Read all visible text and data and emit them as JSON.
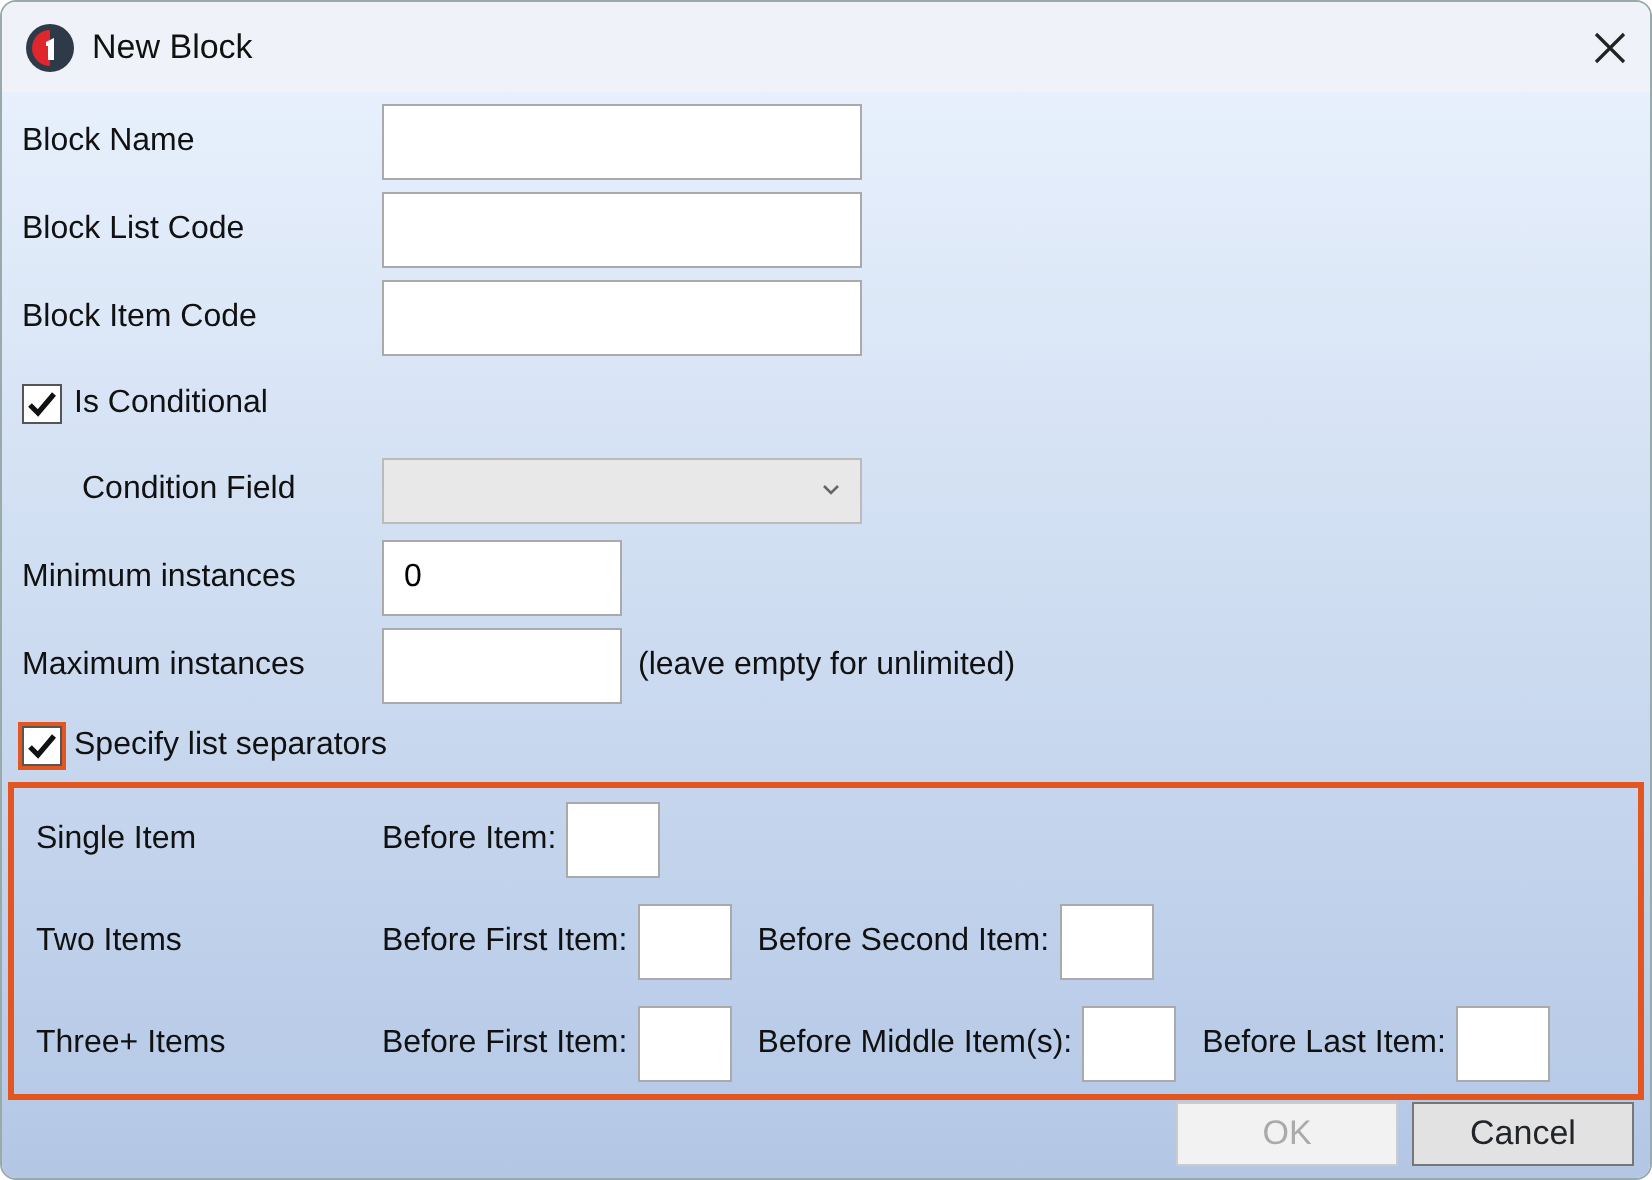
{
  "window": {
    "title": "New Block"
  },
  "fields": [
    {
      "kind": "text",
      "label": "Block Name"
    },
    {
      "kind": "text",
      "label": "Block List Code"
    },
    {
      "kind": "text",
      "label": "Block Item Code"
    },
    {
      "kind": "checkbox",
      "label": "Is Conditional",
      "checked": true,
      "highlighted": false
    },
    {
      "kind": "select",
      "label": "Condition Field",
      "disabled": true
    },
    {
      "kind": "short",
      "label": "Minimum instances",
      "value": "0"
    },
    {
      "kind": "short",
      "label": "Maximum instances",
      "note": "(leave empty for unlimited)"
    },
    {
      "kind": "checkbox",
      "label": "Specify list separators",
      "checked": true,
      "highlighted": true
    }
  ],
  "separators": [
    {
      "label": "Single Item",
      "inputs": [
        {
          "label": "Before Item:"
        }
      ]
    },
    {
      "label": "Two Items",
      "inputs": [
        {
          "label": "Before First Item:"
        },
        {
          "label": "Before Second Item:"
        }
      ]
    },
    {
      "label": "Three+ Items",
      "inputs": [
        {
          "label": "Before First Item:"
        },
        {
          "label": "Before Middle Item(s):"
        },
        {
          "label": "Before Last Item:"
        }
      ]
    }
  ],
  "buttons": [
    {
      "label": "OK",
      "disabled": true
    },
    {
      "label": "Cancel",
      "disabled": false
    }
  ]
}
